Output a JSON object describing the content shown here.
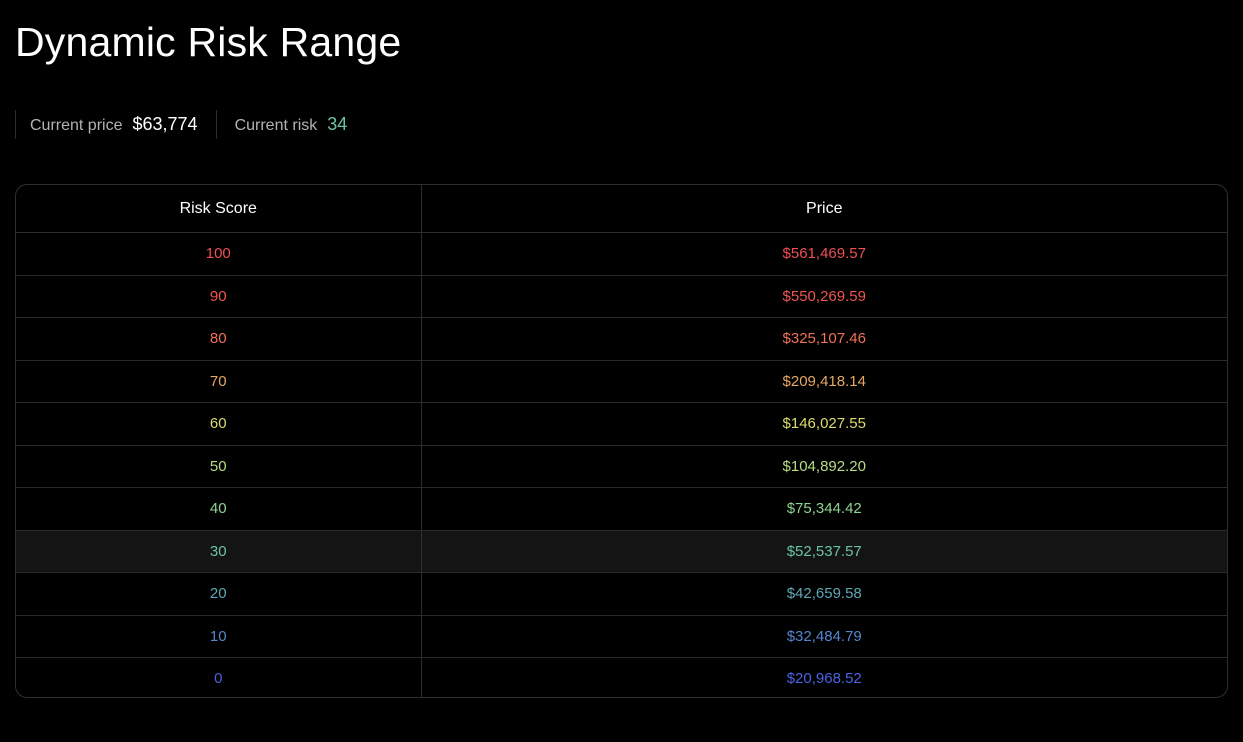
{
  "page": {
    "title": "Dynamic Risk Range"
  },
  "stats": {
    "current_price_label": "Current price",
    "current_price_value": "$63,774",
    "current_risk_label": "Current risk",
    "current_risk_value": "34",
    "current_risk_color": "#6cc3a4"
  },
  "table": {
    "headers": [
      "Risk Score",
      "Price"
    ],
    "rows": [
      {
        "risk": "100",
        "price": "$561,469.57",
        "color": "#ef4f55"
      },
      {
        "risk": "90",
        "price": "$550,269.59",
        "color": "#ef5552"
      },
      {
        "risk": "80",
        "price": "$325,107.46",
        "color": "#ee7258"
      },
      {
        "risk": "70",
        "price": "$209,418.14",
        "color": "#e6a765"
      },
      {
        "risk": "60",
        "price": "$146,027.55",
        "color": "#dcdc6e"
      },
      {
        "risk": "50",
        "price": "$104,892.20",
        "color": "#b7dd85"
      },
      {
        "risk": "40",
        "price": "$75,344.42",
        "color": "#8fd394"
      },
      {
        "risk": "30",
        "price": "$52,537.57",
        "color": "#6cc3a4"
      },
      {
        "risk": "20",
        "price": "$42,659.58",
        "color": "#5fa7b6"
      },
      {
        "risk": "10",
        "price": "$32,484.79",
        "color": "#5685d0"
      },
      {
        "risk": "0",
        "price": "$20,968.52",
        "color": "#4b62e0"
      }
    ],
    "highlighted_row": "30"
  }
}
